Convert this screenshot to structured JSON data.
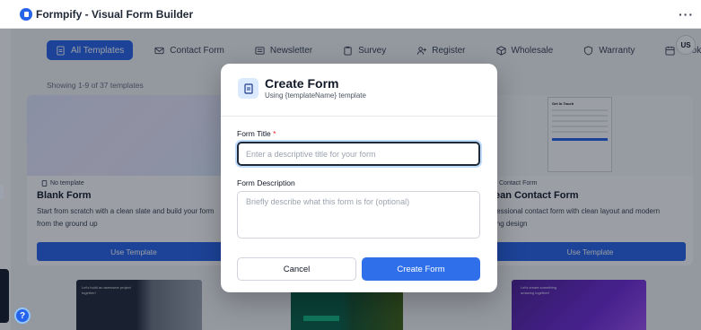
{
  "window": {
    "title": "Formpify - Visual Form Builder",
    "menu_label": "···"
  },
  "user": {
    "initials": "US"
  },
  "tabs": [
    {
      "label": "All Templates",
      "icon": "document-icon",
      "active": true
    },
    {
      "label": "Contact Form",
      "icon": "mail-icon",
      "active": false
    },
    {
      "label": "Newsletter",
      "icon": "newspaper-icon",
      "active": false
    },
    {
      "label": "Survey",
      "icon": "clipboard-icon",
      "active": false
    },
    {
      "label": "Register",
      "icon": "user-plus-icon",
      "active": false
    },
    {
      "label": "Wholesale",
      "icon": "box-icon",
      "active": false
    },
    {
      "label": "Warranty",
      "icon": "shield-icon",
      "active": false
    },
    {
      "label": "Booking",
      "icon": "calendar-icon",
      "active": false
    }
  ],
  "showing_text": "Showing 1-9 of 37 templates",
  "cards": {
    "left": {
      "tag": "No template",
      "title": "Blank Form",
      "description_line1": "Start from scratch with a clean slate and build your form",
      "description_line2": "from the ground up",
      "button": "Use Template"
    },
    "right": {
      "tag": "Contact Form",
      "title": "ean Contact Form",
      "description_line1": "fessional contact form with clean layout and modern",
      "description_line2": "ing design",
      "button": "Use Template",
      "preview_heading": "Get In Touch"
    }
  },
  "thumbs": {
    "one_text": "Let's build an awesome project together!",
    "three_text": "Let's create something amazing together!"
  },
  "modal": {
    "title": "Create Form",
    "subtitle": "Using {templateName} template",
    "form_title_label": "Form Title",
    "required_marker": "*",
    "form_title_placeholder": "Enter a descriptive title for your form",
    "form_title_value": "",
    "description_label": "Form Description",
    "description_placeholder": "Briefly describe what this form is for (optional)",
    "description_value": "",
    "cancel_label": "Cancel",
    "create_label": "Create Form"
  },
  "help": {
    "icon_glyph": "?"
  },
  "colors": {
    "accent": "#2563eb",
    "overlay": "rgba(17,24,39,0.42)",
    "required": "#dc2626"
  }
}
